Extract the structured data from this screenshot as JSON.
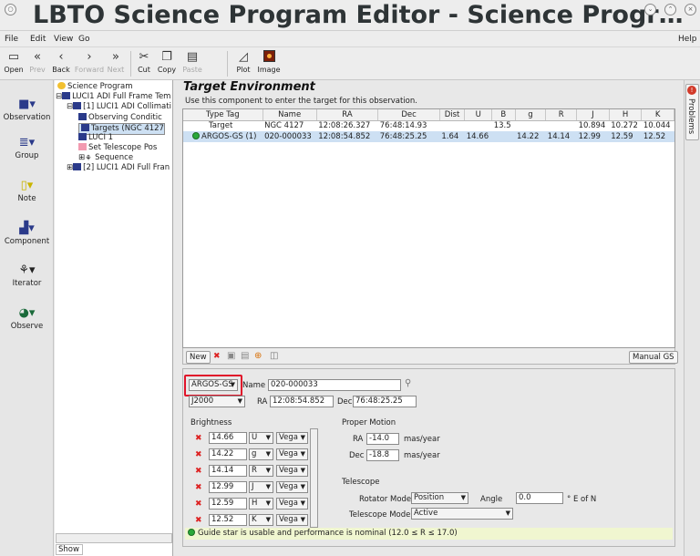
{
  "window": {
    "title": "LBTO Science Program Editor - Science Progr…"
  },
  "menubar": {
    "file": "File",
    "edit": "Edit",
    "view": "View",
    "go": "Go",
    "help": "Help"
  },
  "toolbar": {
    "open": "Open",
    "prev": "Prev",
    "back": "Back",
    "forward": "Forward",
    "next": "Next",
    "cut": "Cut",
    "copy": "Copy",
    "paste": "Paste",
    "plot": "Plot",
    "image": "Image"
  },
  "leftbar": {
    "observation": "Observation",
    "group": "Group",
    "note": "Note",
    "component": "Component",
    "iterator": "Iterator",
    "observe": "Observe"
  },
  "tree": {
    "items": [
      "Science Program",
      "LUCI1 ADI  Full Frame Tem",
      "[1] LUCI1 ADI Collimati",
      "Observing Conditic",
      "Targets (NGC 4127",
      "LUCI 1",
      "Set Telescope Pos",
      "Sequence",
      "[2] LUCI1 ADI Full Fran"
    ],
    "show": "Show"
  },
  "main": {
    "title": "Target Environment",
    "subtitle": "Use this component to enter the target for this observation."
  },
  "table": {
    "headers": [
      "Type Tag",
      "Name",
      "RA",
      "Dec",
      "Dist",
      "U",
      "B",
      "g",
      "R",
      "J",
      "H",
      "K"
    ],
    "rows": [
      [
        "Target",
        "NGC 4127",
        "12:08:26.327",
        "76:48:14.93",
        "",
        "",
        "13.5",
        "",
        "",
        "10.894",
        "10.272",
        "10.044"
      ],
      [
        "ARGOS-GS (1)",
        "020-000033",
        "12:08:54.852",
        "76:48:25.25",
        "1.64",
        "14.66",
        "",
        "14.22",
        "14.14",
        "12.99",
        "12.59",
        "12.52"
      ]
    ]
  },
  "tablebar": {
    "new": "New",
    "manual_gs": "Manual GS"
  },
  "form": {
    "tag": "ARGOS-GS",
    "name_label": "Name",
    "name_value": "020-000033",
    "frame": "J2000",
    "ra_label": "RA",
    "ra_value": "12:08:54.852",
    "dec_label": "Dec",
    "dec_value": "76:48:25.25",
    "brightness_label": "Brightness",
    "brightness": [
      {
        "value": "14.66",
        "band": "U",
        "system": "Vega"
      },
      {
        "value": "14.22",
        "band": "g",
        "system": "Vega"
      },
      {
        "value": "14.14",
        "band": "R",
        "system": "Vega"
      },
      {
        "value": "12.99",
        "band": "J",
        "system": "Vega"
      },
      {
        "value": "12.59",
        "band": "H",
        "system": "Vega"
      },
      {
        "value": "12.52",
        "band": "K",
        "system": "Vega"
      }
    ],
    "proper_motion_label": "Proper Motion",
    "pm_ra_label": "RA",
    "pm_ra_value": "-14.0",
    "pm_dec_label": "Dec",
    "pm_dec_value": "-18.8",
    "pm_unit": "mas/year",
    "telescope_label": "Telescope",
    "rotator_mode_label": "Rotator Mode",
    "rotator_mode_value": "Position",
    "angle_label": "Angle",
    "angle_value": "0.0",
    "angle_unit": "° E of N",
    "telescope_mode_label": "Telescope Mode",
    "telescope_mode_value": "Active",
    "status": "Guide star is usable and performance is nominal (12.0 ≤ R ≤ 17.0)"
  },
  "rightbar": {
    "problems": "Problems"
  },
  "colors": {
    "highlight": "#e0142a",
    "selection": "#cde0f3",
    "status_bg": "#f0f6d0",
    "ok": "#2aa83a"
  }
}
